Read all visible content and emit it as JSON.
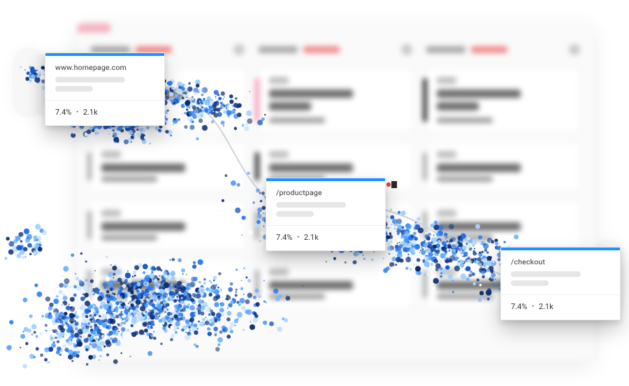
{
  "accent": "#1f90ff",
  "steps": [
    {
      "title": "www.homepage.com",
      "percent": "7.4%",
      "count": "2.1k"
    },
    {
      "title": "/productpage",
      "percent": "7.4%",
      "count": "2.1k"
    },
    {
      "title": "/checkout",
      "percent": "7.4%",
      "count": "2.1k"
    }
  ]
}
